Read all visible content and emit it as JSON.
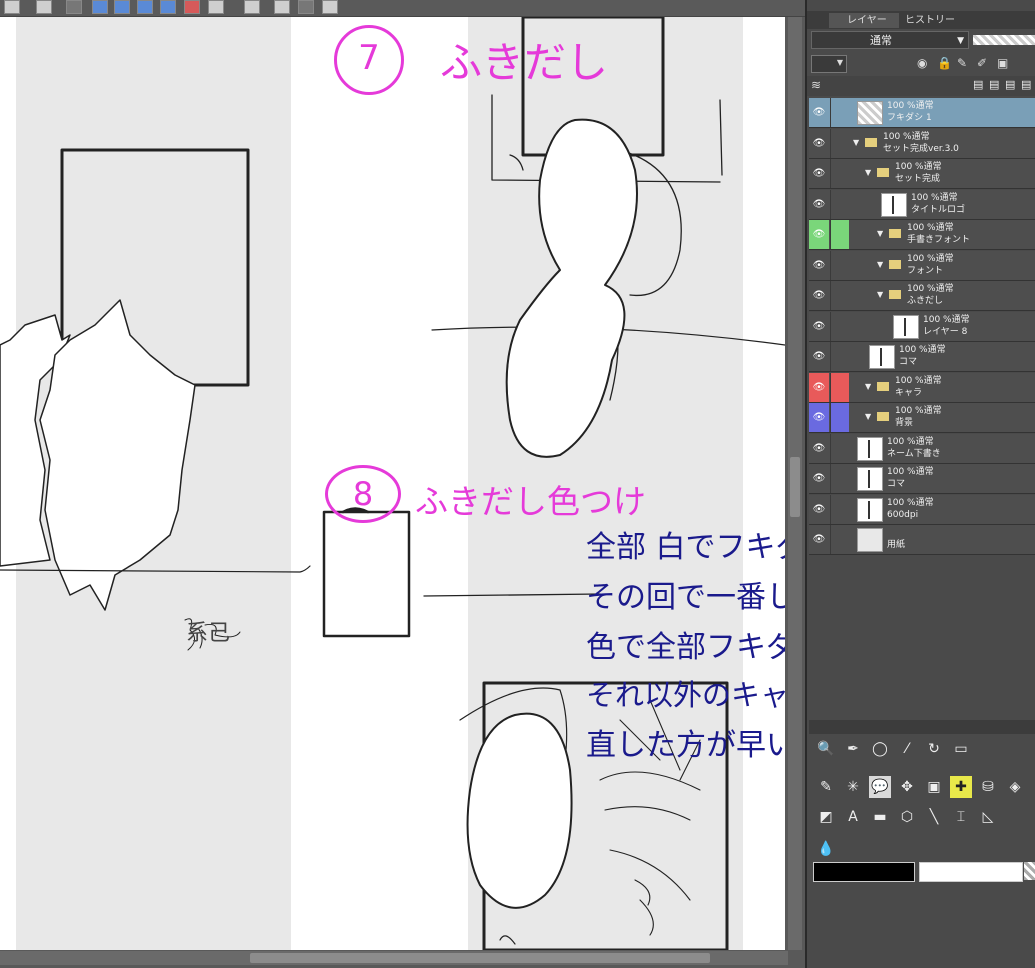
{
  "annotations": {
    "step7_number": "7",
    "step7_title": "ふきだし",
    "step8_number": "8",
    "step8_title": "ふきだし色つけ",
    "memo_lines": [
      "全部 白でフキダシ書くより",
      "その回で一番しゃべってる奴の",
      "色で全部フキダシ作って",
      "それ以外のキャラのフキダシの色",
      "直した方が早い(ミスは増える)"
    ],
    "sketch_note": "系己"
  },
  "colors": {
    "annotation_pink": "#e53ad9",
    "memo_navy": "#1a1a8c",
    "layer_selected": "#7a9fb7",
    "label_green": "#7ad67a",
    "label_red": "#e85a5a",
    "label_blue": "#6a6ae0"
  },
  "panel": {
    "tab_layer": "レイヤー",
    "tab_history": "ヒストリー",
    "blend_mode": "通常"
  },
  "layers": [
    {
      "opacity_mode": "100 %通常",
      "name": "フキダシ 1",
      "type": "balloon",
      "indent": 0,
      "selected": true,
      "visible": true
    },
    {
      "opacity_mode": "100 %通常",
      "name": "セット完成ver.3.0",
      "type": "folder",
      "indent": 0,
      "visible": true
    },
    {
      "opacity_mode": "100 %通常",
      "name": "セット完成",
      "type": "folder",
      "indent": 1,
      "visible": true
    },
    {
      "opacity_mode": "100 %通常",
      "name": "タイトルロゴ",
      "type": "raster",
      "indent": 2,
      "visible": true
    },
    {
      "opacity_mode": "100 %通常",
      "name": "手書きフォント",
      "type": "folder",
      "indent": 2,
      "visible": true,
      "color_label": "green"
    },
    {
      "opacity_mode": "100 %通常",
      "name": "フォント",
      "type": "folder",
      "indent": 2,
      "visible": true
    },
    {
      "opacity_mode": "100 %通常",
      "name": "ふきだし",
      "type": "folder",
      "indent": 2,
      "visible": true
    },
    {
      "opacity_mode": "100 %通常",
      "name": "レイヤー 8",
      "type": "raster",
      "indent": 3,
      "visible": true
    },
    {
      "opacity_mode": "100 %通常",
      "name": "コマ",
      "type": "frame",
      "indent": 1,
      "visible": true
    },
    {
      "opacity_mode": "100 %通常",
      "name": "キャラ",
      "type": "folder",
      "indent": 1,
      "visible": true,
      "color_label": "red"
    },
    {
      "opacity_mode": "100 %通常",
      "name": "背景",
      "type": "folder",
      "indent": 1,
      "visible": true,
      "color_label": "blue"
    },
    {
      "opacity_mode": "100 %通常",
      "name": "ネーム下書き",
      "type": "raster",
      "indent": 0,
      "visible": true
    },
    {
      "opacity_mode": "100 %通常",
      "name": "コマ",
      "type": "frame",
      "indent": 0,
      "visible": true
    },
    {
      "opacity_mode": "100 %通常",
      "name": "600dpi",
      "type": "raster",
      "indent": 0,
      "visible": true
    },
    {
      "opacity_mode": "",
      "name": "用紙",
      "type": "paper",
      "indent": 0,
      "visible": true
    }
  ],
  "tools": [
    [
      "magnifier-icon",
      "pen-icon",
      "lasso-icon",
      "eyedropper-icon",
      "rotate-icon",
      "eraser-icon"
    ],
    [
      "brush-icon",
      "sparkle-icon",
      "balloon-icon",
      "move-icon",
      "layer-move-icon",
      "select-plus-icon",
      "bucket-icon",
      "fill-icon"
    ],
    [
      "gradient-icon",
      "text-icon",
      "ruler-icon",
      "polygon-icon",
      "line-pen-icon",
      "correction-icon",
      "triangle-ruler-icon"
    ],
    [
      "water-drop-icon"
    ]
  ]
}
